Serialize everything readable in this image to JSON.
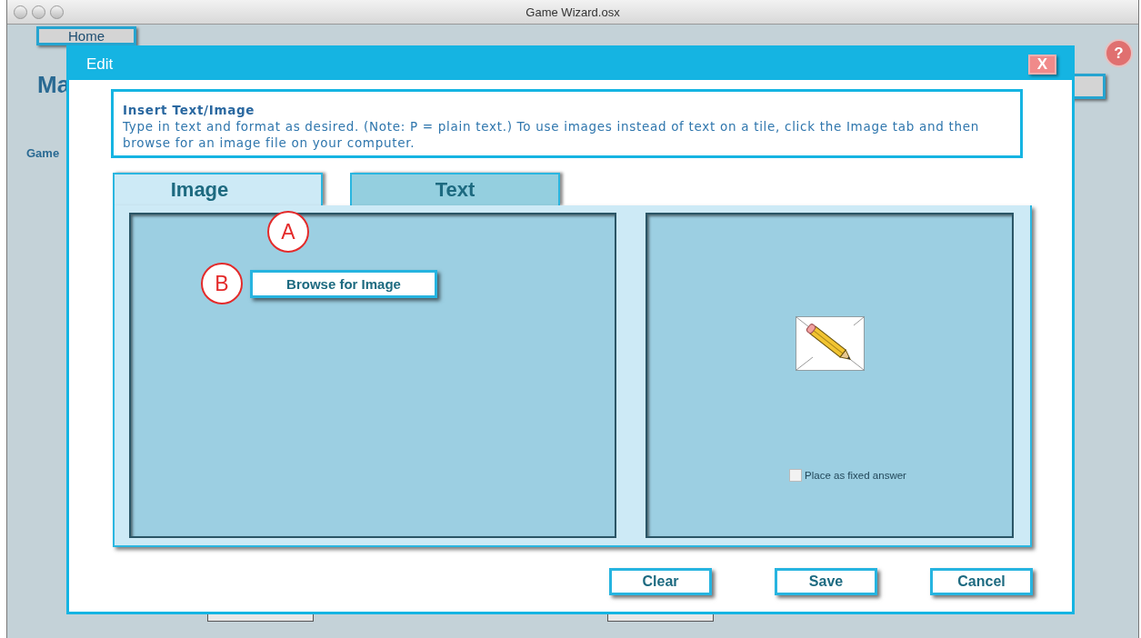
{
  "window": {
    "title": "Game Wizard.osx"
  },
  "background": {
    "home_button": "Home",
    "heading": "Ma",
    "label": "Game",
    "help_button": "?"
  },
  "dialog": {
    "title": "Edit",
    "close_button": "X",
    "info": {
      "heading": "Insert Text/Image",
      "body": "Type in text and format as desired. (Note: P = plain text.) To use images instead of text on a tile, click the Image tab and then browse for an image file on your computer."
    },
    "tabs": [
      {
        "label": "Image",
        "selected": true
      },
      {
        "label": "Text",
        "selected": false
      }
    ],
    "browse_button": "Browse for Image",
    "checkbox": {
      "label": "Place as fixed answer",
      "checked": false
    },
    "buttons": [
      "Clear",
      "Save",
      "Cancel"
    ]
  },
  "annotations": [
    "A",
    "B"
  ]
}
